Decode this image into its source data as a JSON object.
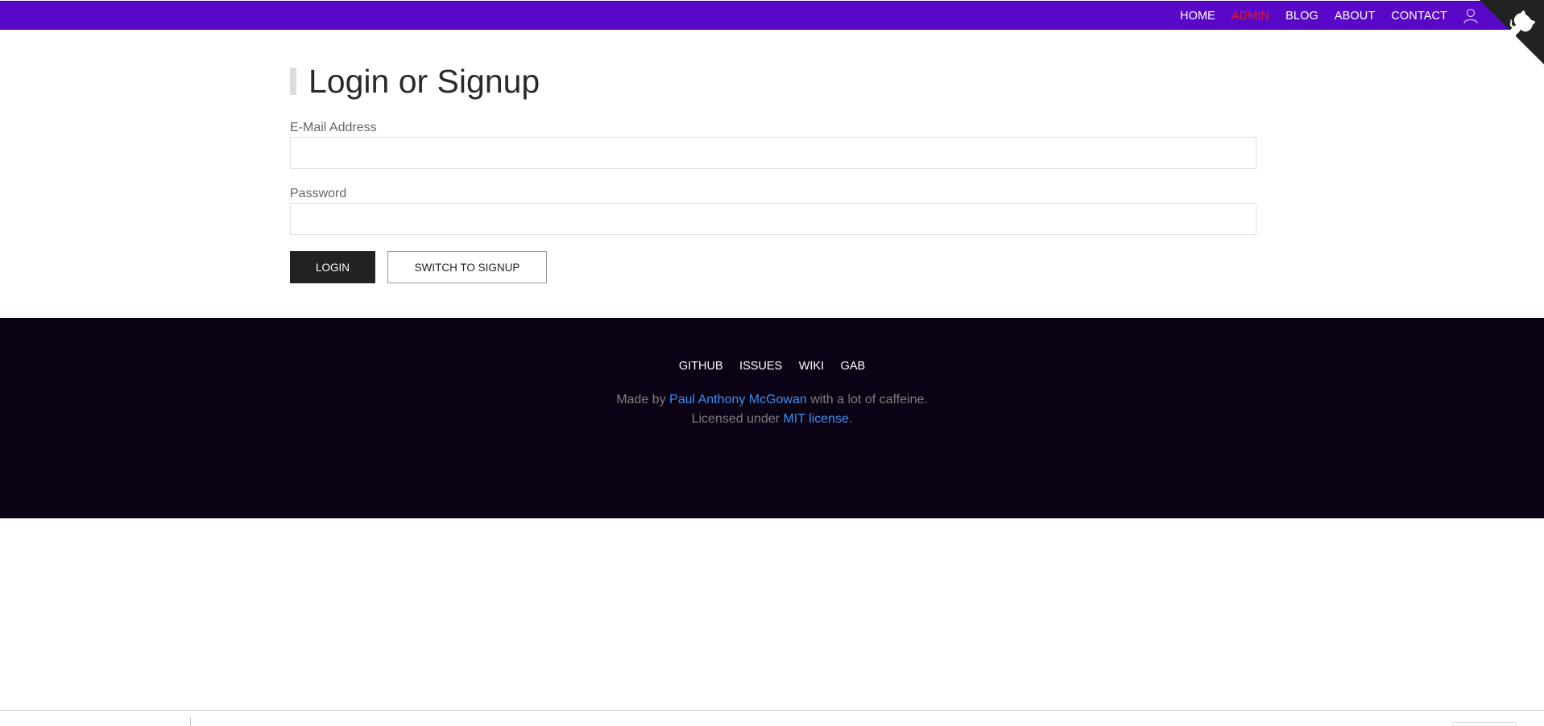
{
  "nav": {
    "items": [
      {
        "label": "HOME",
        "active": false
      },
      {
        "label": "ADMIN",
        "active": true
      },
      {
        "label": "BLOG",
        "active": false
      },
      {
        "label": "ABOUT",
        "active": false
      },
      {
        "label": "CONTACT",
        "active": false
      }
    ],
    "user_icon": "user-icon",
    "corner_icon": "github-octocat-icon"
  },
  "main": {
    "title": "Login or Signup",
    "email_label": "E-Mail Address",
    "email_value": "",
    "password_label": "Password",
    "password_value": "",
    "login_button": "LOGIN",
    "switch_button": "SWITCH TO SIGNUP"
  },
  "footer": {
    "links": [
      "GITHUB",
      "ISSUES",
      "WIKI",
      "GAB"
    ],
    "made_by_prefix": "Made by ",
    "author": "Paul Anthony McGowan",
    "made_by_suffix": " with a lot of caffeine.",
    "license_prefix": "Licensed under ",
    "license_link": "MIT license",
    "license_suffix": "."
  },
  "colors": {
    "topbar": "#5a08c8",
    "nav_active": "#e2182a",
    "footer_bg": "#0b0315",
    "link": "#3b8ff0",
    "button_dark": "#222222"
  }
}
